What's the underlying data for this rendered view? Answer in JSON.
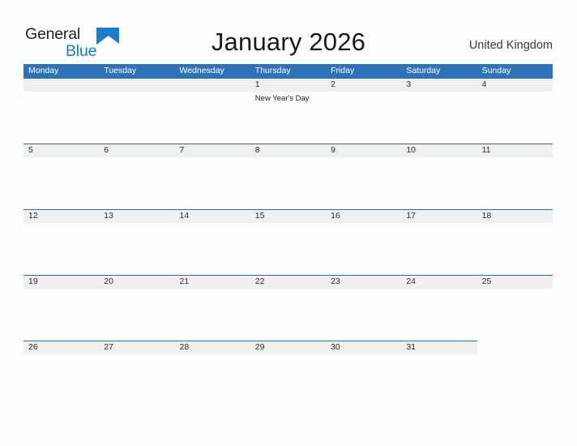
{
  "brand": {
    "name_part1": "General",
    "name_part2": "Blue",
    "triangle_color": "#1c7cc4",
    "text_color": "#231f20"
  },
  "header": {
    "title": "January 2026",
    "country": "United Kingdom"
  },
  "theme": {
    "header_blue": "#2e73b8",
    "rule_blue": "#2e6da4",
    "band_gray": "#f0f0f0",
    "page_background": "#fcfdfd"
  },
  "calendar": {
    "month": "January",
    "year": "2026",
    "weekday_headers": [
      "Monday",
      "Tuesday",
      "Wednesday",
      "Thursday",
      "Friday",
      "Saturday",
      "Sunday"
    ],
    "weeks": [
      {
        "band_columns": 7,
        "days": [
          {
            "number": "",
            "events": []
          },
          {
            "number": "",
            "events": []
          },
          {
            "number": "",
            "events": []
          },
          {
            "number": "1",
            "events": [
              "New Year's Day"
            ]
          },
          {
            "number": "2",
            "events": []
          },
          {
            "number": "3",
            "events": []
          },
          {
            "number": "4",
            "events": []
          }
        ]
      },
      {
        "band_columns": 7,
        "days": [
          {
            "number": "5",
            "events": []
          },
          {
            "number": "6",
            "events": []
          },
          {
            "number": "7",
            "events": []
          },
          {
            "number": "8",
            "events": []
          },
          {
            "number": "9",
            "events": []
          },
          {
            "number": "10",
            "events": []
          },
          {
            "number": "11",
            "events": []
          }
        ]
      },
      {
        "band_columns": 7,
        "days": [
          {
            "number": "12",
            "events": []
          },
          {
            "number": "13",
            "events": []
          },
          {
            "number": "14",
            "events": []
          },
          {
            "number": "15",
            "events": []
          },
          {
            "number": "16",
            "events": []
          },
          {
            "number": "17",
            "events": []
          },
          {
            "number": "18",
            "events": []
          }
        ]
      },
      {
        "band_columns": 7,
        "days": [
          {
            "number": "19",
            "events": []
          },
          {
            "number": "20",
            "events": []
          },
          {
            "number": "21",
            "events": []
          },
          {
            "number": "22",
            "events": []
          },
          {
            "number": "23",
            "events": []
          },
          {
            "number": "24",
            "events": []
          },
          {
            "number": "25",
            "events": []
          }
        ]
      },
      {
        "band_columns": 6,
        "days": [
          {
            "number": "26",
            "events": []
          },
          {
            "number": "27",
            "events": []
          },
          {
            "number": "28",
            "events": []
          },
          {
            "number": "29",
            "events": []
          },
          {
            "number": "30",
            "events": []
          },
          {
            "number": "31",
            "events": []
          },
          {
            "number": "",
            "events": []
          }
        ]
      }
    ]
  }
}
